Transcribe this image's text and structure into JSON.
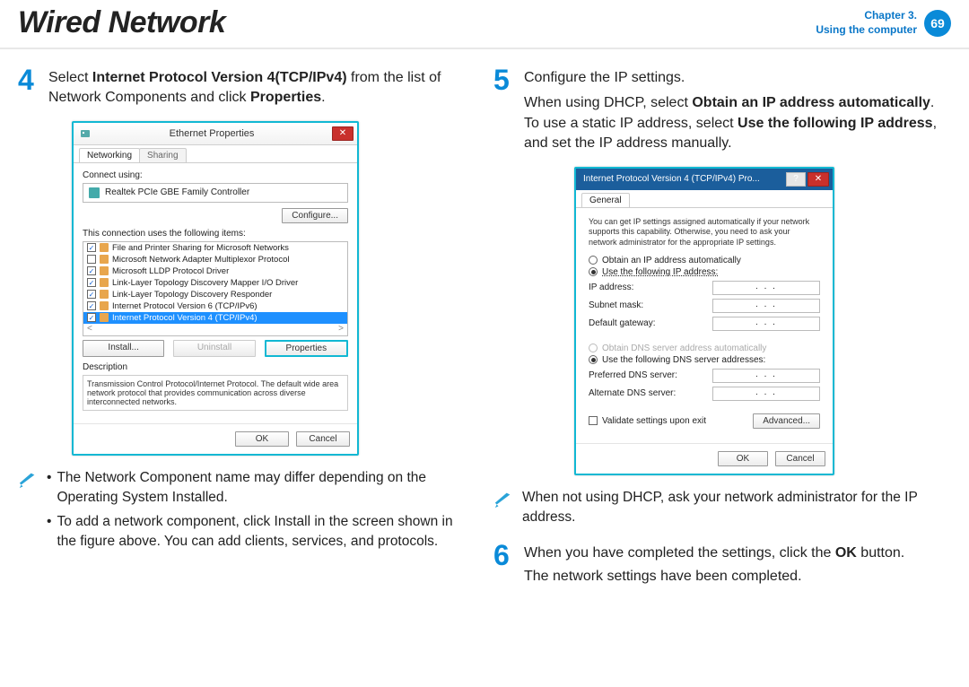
{
  "header": {
    "title": "Wired Network",
    "chapter_line1": "Chapter 3.",
    "chapter_line2": "Using the computer",
    "page": "69"
  },
  "step4": {
    "num": "4",
    "text_a": "Select ",
    "text_b": "Internet Protocol Version 4(TCP/IPv4)",
    "text_c": " from the list of Network Components and click ",
    "text_d": "Properties",
    "text_e": "."
  },
  "step5": {
    "num": "5",
    "line1": "Configure the IP settings.",
    "line2_a": "When using DHCP, select ",
    "line2_b": "Obtain an IP address automatically",
    "line2_c": ". To use a static IP address, select ",
    "line2_d": "Use the following IP address",
    "line2_e": ", and set the IP address manually."
  },
  "step6": {
    "num": "6",
    "text_a": "When you have completed the settings, click the ",
    "text_b": "OK",
    "text_c": " button.",
    "line2": "The network settings have been completed."
  },
  "note_left": {
    "b1": "The Network Component name may differ depending on the Operating System Installed.",
    "b2": "To add a network component, click Install in the screen shown in the figure above. You can add clients, services, and protocols."
  },
  "note_right": {
    "text": "When not using DHCP, ask your network administrator for the IP address."
  },
  "dlg1": {
    "title": "Ethernet Properties",
    "tab1": "Networking",
    "tab2": "Sharing",
    "connect_using": "Connect using:",
    "adapter": "Realtek PCIe GBE Family Controller",
    "configure_btn": "Configure...",
    "items_label": "This connection uses the following items:",
    "items": [
      {
        "chk": true,
        "label": "File and Printer Sharing for Microsoft Networks"
      },
      {
        "chk": false,
        "label": "Microsoft Network Adapter Multiplexor Protocol"
      },
      {
        "chk": true,
        "label": "Microsoft LLDP Protocol Driver"
      },
      {
        "chk": true,
        "label": "Link-Layer Topology Discovery Mapper I/O Driver"
      },
      {
        "chk": true,
        "label": "Link-Layer Topology Discovery Responder"
      },
      {
        "chk": true,
        "label": "Internet Protocol Version 6 (TCP/IPv6)"
      },
      {
        "chk": true,
        "label": "Internet Protocol Version 4 (TCP/IPv4)",
        "selected": true
      }
    ],
    "install_btn": "Install...",
    "uninstall_btn": "Uninstall",
    "properties_btn": "Properties",
    "desc_label": "Description",
    "desc_text": "Transmission Control Protocol/Internet Protocol. The default wide area network protocol that provides communication across diverse interconnected networks.",
    "ok": "OK",
    "cancel": "Cancel"
  },
  "dlg2": {
    "title": "Internet Protocol Version 4 (TCP/IPv4) Pro...",
    "tab": "General",
    "info": "You can get IP settings assigned automatically if your network supports this capability. Otherwise, you need to ask your network administrator for the appropriate IP settings.",
    "r_auto_ip": "Obtain an IP address automatically",
    "r_use_ip": "Use the following IP address:",
    "ip_addr": "IP address:",
    "subnet": "Subnet mask:",
    "gateway": "Default gateway:",
    "r_auto_dns": "Obtain DNS server address automatically",
    "r_use_dns": "Use the following DNS server addresses:",
    "pref_dns": "Preferred DNS server:",
    "alt_dns": "Alternate DNS server:",
    "validate": "Validate settings upon exit",
    "advanced": "Advanced...",
    "ok": "OK",
    "cancel": "Cancel",
    "dots": ".     .     ."
  }
}
